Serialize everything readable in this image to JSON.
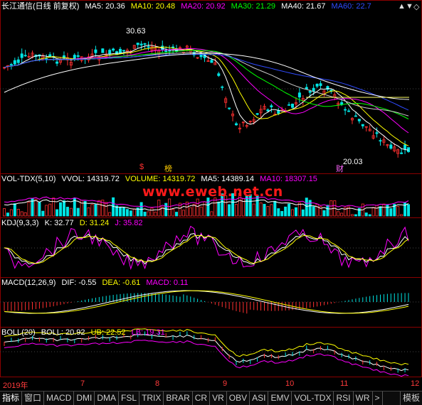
{
  "main": {
    "title": "长江通信(日线 前复权)",
    "ma": [
      {
        "label": "MA5: 20.36",
        "color": "#ffffff"
      },
      {
        "label": "MA10: 20.48",
        "color": "#ffff00"
      },
      {
        "label": "MA20: 20.92",
        "color": "#ff00ff"
      },
      {
        "label": "MA30: 21.29",
        "color": "#00ff00"
      },
      {
        "label": "MA40: 21.67",
        "color": "#ffffff"
      },
      {
        "label": "MA60: 22.7",
        "color": "#0000ff"
      }
    ],
    "high_label": "30.63",
    "low_label": "20.03",
    "marker_s": "$",
    "marker_bang": "榜",
    "marker_cai": "财"
  },
  "controls": {
    "up": "▲",
    "down": "▼",
    "diamond": "◇"
  },
  "vol": {
    "title": "VOL-TDX(5,10)",
    "vvol": "VVOL: 14319.72",
    "volume": "VOLUME: 14319.72",
    "ma5": "MA5: 14389.14",
    "ma10": "MA10: 18307.15"
  },
  "watermark": "www.eweb.net.cn",
  "kdj": {
    "title": "KDJ(9,3,3)",
    "k": "K: 32.77",
    "d": "D: 31.24",
    "j": "J: 35.82"
  },
  "macd": {
    "title": "MACD(12,26,9)",
    "dif": "DIF: -0.55",
    "dea": "DEA: -0.61",
    "macd": "MACD: 0.11"
  },
  "boll": {
    "title": "BOLL(20)",
    "boll": "BOLL: 20.92",
    "ub": "UB: 22.52",
    "lb": "LB: 19.31"
  },
  "xaxis": [
    "2019年",
    "7",
    "8",
    "9",
    "10",
    "11",
    "12"
  ],
  "tabs": [
    "指标",
    "窗口",
    "MACD",
    "DMI",
    "DMA",
    "FSL",
    "TRIX",
    "BRAR",
    "CR",
    "VR",
    "OBV",
    "ASI",
    "EMV",
    "VOL-TDX",
    "RSI",
    "WR",
    ">"
  ],
  "tab_right": "模板"
}
